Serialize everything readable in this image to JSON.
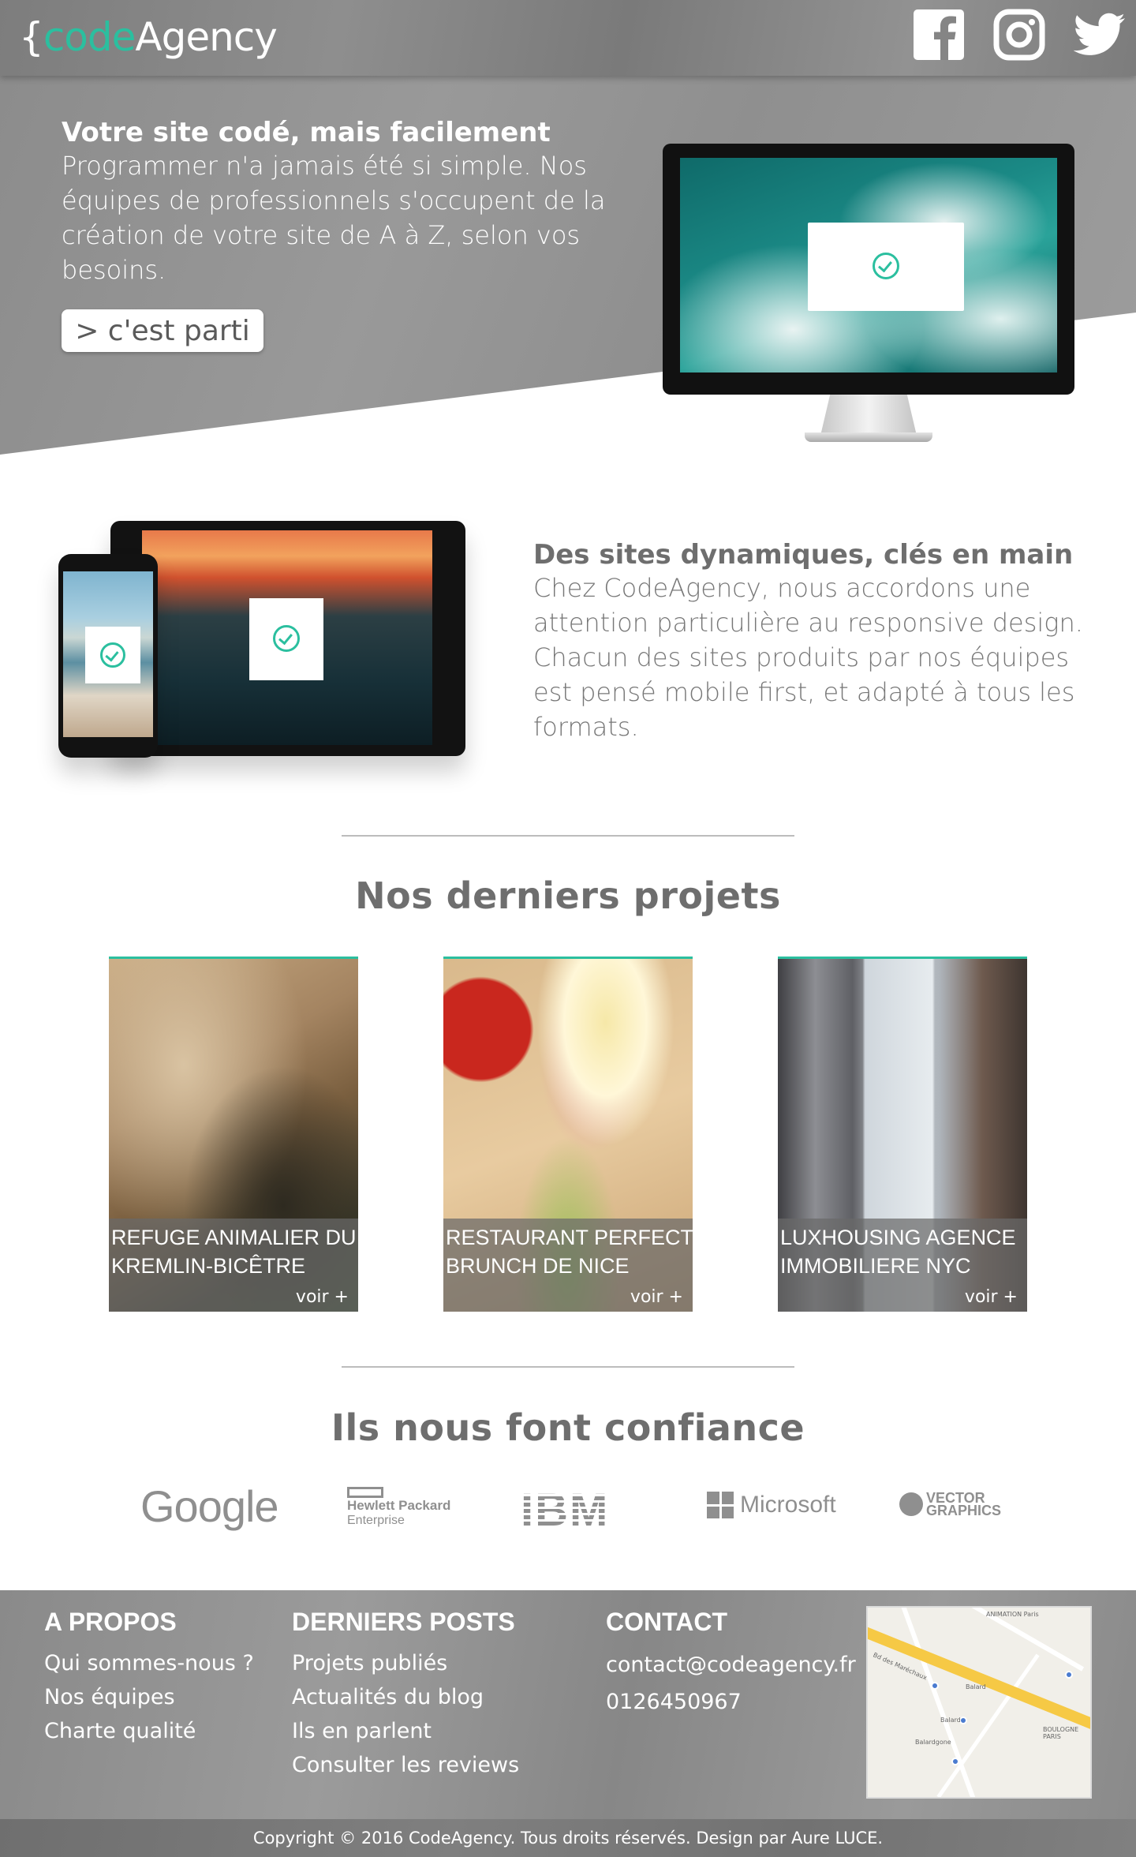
{
  "header": {
    "logo": {
      "brace": "{",
      "accent": "code",
      "rest": "Agency"
    },
    "socials": [
      {
        "name": "facebook",
        "icon": "facebook-icon"
      },
      {
        "name": "instagram",
        "icon": "instagram-icon"
      },
      {
        "name": "twitter",
        "icon": "twitter-icon"
      }
    ]
  },
  "hero": {
    "title": "Votre site codé, mais facilement",
    "description": "Programmer n'a jamais été si simple. Nos équipes de professionnels s'occupent de la création de votre site de A à Z, selon vos besoins.",
    "cta_label": "> c'est parti"
  },
  "feature": {
    "title": "Des sites dynamiques, clés en main",
    "description": "Chez CodeAgency, nous accordons une attention particulière au responsive design. Chacun des sites produits par nos équipes est pensé mobile first, et adapté à tous les formats."
  },
  "projects": {
    "title": "Nos derniers projets",
    "items": [
      {
        "name": "Refuge animalier du\nKremlin-Bicêtre",
        "more": "voir +"
      },
      {
        "name": "Restaurant Perfect\nBrunch de Nice",
        "more": "voir +"
      },
      {
        "name": "Luxhousing agence\nimmobiliere NYC",
        "more": "voir +"
      }
    ]
  },
  "clients": {
    "title": "Ils nous font confiance",
    "logos": {
      "google": "Google",
      "hpe_line1": "Hewlett Packard",
      "hpe_line2": "Enterprise",
      "ibm": "IBM",
      "microsoft": "Microsoft",
      "vector_line1": "VECTOR",
      "vector_line2": "GRAPHICS"
    }
  },
  "footer": {
    "about": {
      "heading": "A PROPOS",
      "links": [
        "Qui sommes-nous ?",
        "Nos équipes",
        "Charte qualité"
      ]
    },
    "posts": {
      "heading": "DERNIERS POSTS",
      "links": [
        "Projets publiés",
        "Actualités du blog",
        "Ils en parlent",
        "Consulter les reviews"
      ]
    },
    "contact": {
      "heading": "CONTACT",
      "email": "contact@codeagency.fr",
      "phone": "0126450967"
    },
    "map": {
      "labels": [
        "ANIMATION Paris",
        "Balard",
        "Balard",
        "Balardgone",
        "Bd des Maréchaux",
        "BOULOGNE PARIS"
      ]
    },
    "copyright": "Copyright © 2016 CodeAgency. Tous droits réservés. Design par Aure LUCE."
  },
  "colors": {
    "accent": "#2bbf9f",
    "header_gray": "#858585",
    "text_gray": "#6e6e6e"
  }
}
